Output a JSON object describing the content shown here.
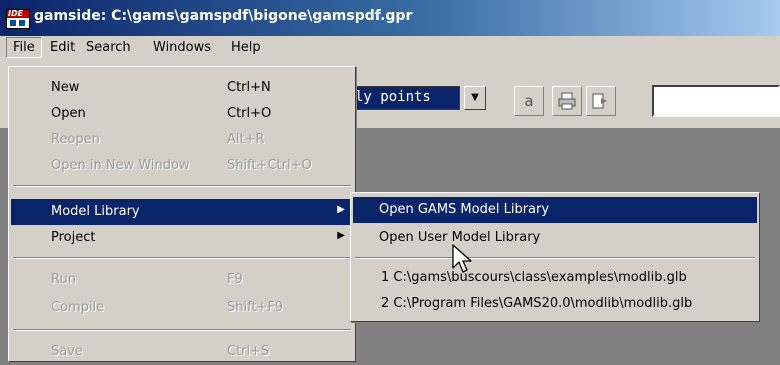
{
  "window": {
    "title": "gamside: C:\\gams\\gamspdf\\bigone\\gamspdf.gpr",
    "icon_label": "IDE"
  },
  "menubar": {
    "items": [
      "File",
      "Edit",
      "Search",
      "Windows",
      "Help"
    ]
  },
  "toolbar": {
    "combo_value": "ly points",
    "combo_arrow": "▼",
    "btn_a": "a",
    "btn_print": "printer-icon",
    "btn_export": "export-icon"
  },
  "file_menu": {
    "new": {
      "label": "New",
      "shortcut": "Ctrl+N"
    },
    "open": {
      "label": "Open",
      "shortcut": "Ctrl+O"
    },
    "reopen": {
      "label": "Reopen",
      "shortcut": "Alt+R"
    },
    "open_new_window": {
      "label": "Open in New Window",
      "shortcut": "Shift+Ctrl+O"
    },
    "model_library": {
      "label": "Model Library"
    },
    "project": {
      "label": "Project"
    },
    "run": {
      "label": "Run",
      "shortcut": "F9"
    },
    "compile": {
      "label": "Compile",
      "shortcut": "Shift+F9"
    },
    "save": {
      "label": "Save",
      "shortcut": "Ctrl+S"
    }
  },
  "submenu": {
    "open_gams_lib": "Open GAMS Model Library",
    "open_user_lib": "Open User Model Library",
    "recent1": "1 C:\\gams\\buscours\\class\\examples\\modlib.glb",
    "recent2": "2 C:\\Program Files\\GAMS20.0\\modlib\\modlib.glb"
  },
  "colors": {
    "highlight": "#0a246a",
    "menu_bg": "#d4d0c8",
    "workspace": "#808080"
  }
}
